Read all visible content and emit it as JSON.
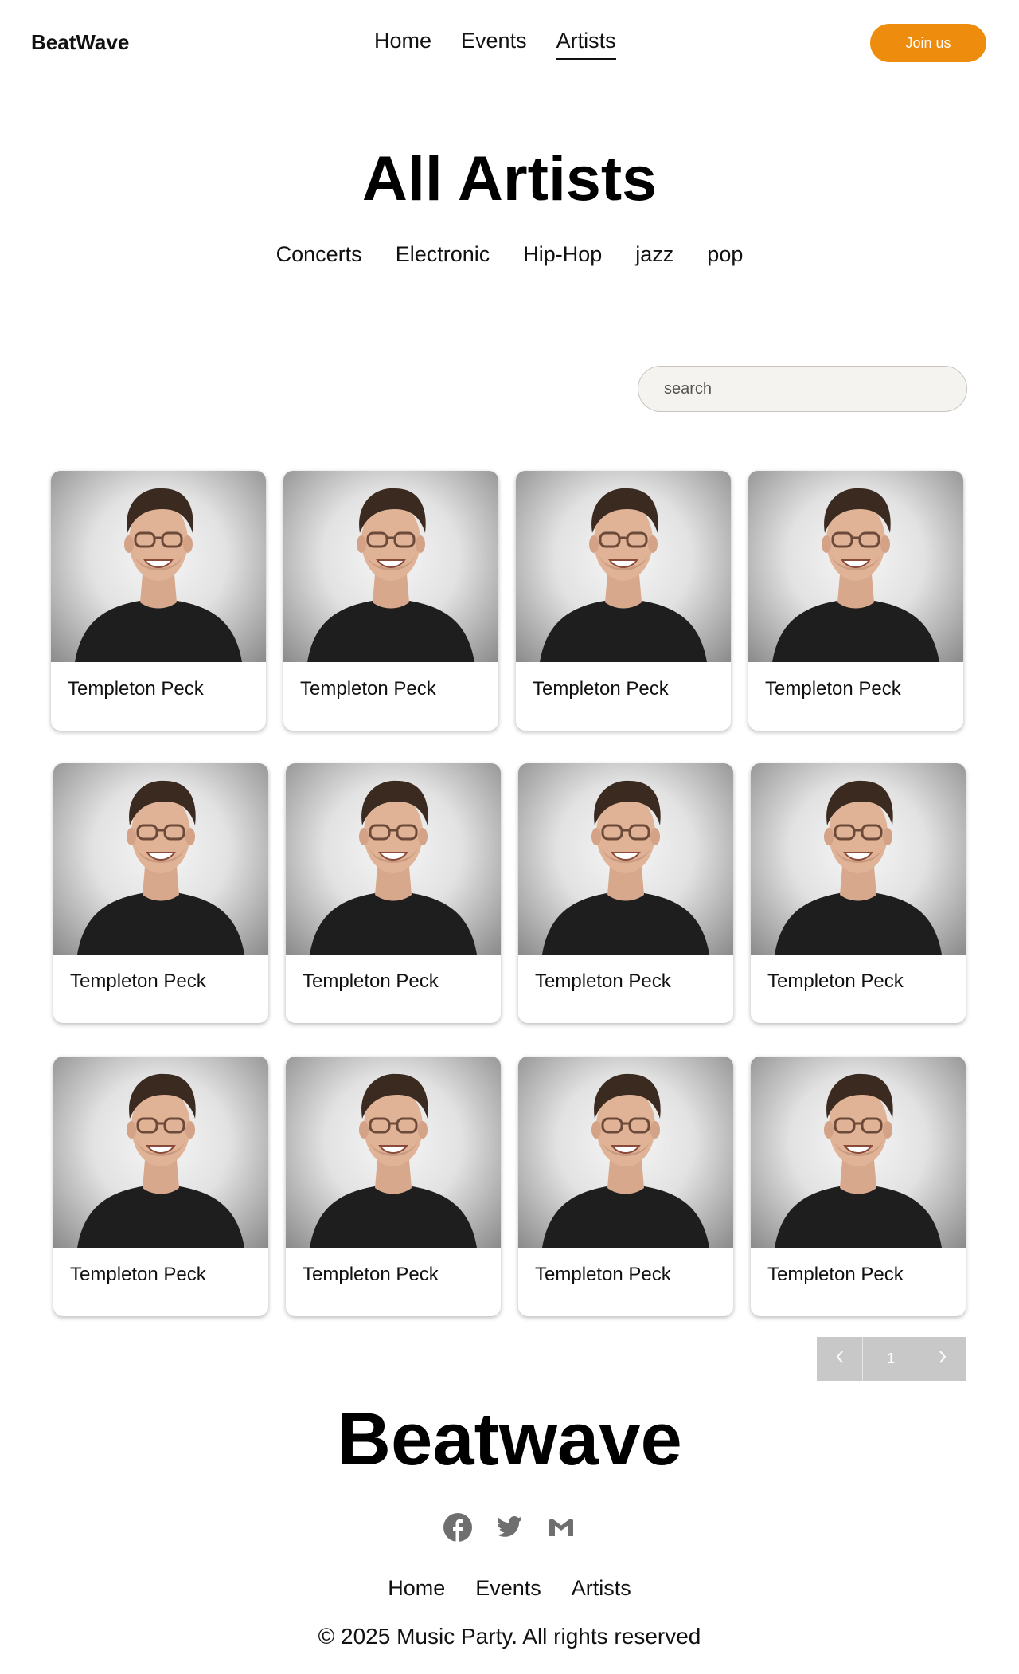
{
  "header": {
    "brand": "BeatWave",
    "nav": [
      {
        "label": "Home",
        "active": false
      },
      {
        "label": "Events",
        "active": false
      },
      {
        "label": "Artists",
        "active": true
      }
    ],
    "join_label": "Join us"
  },
  "hero": {
    "title": "All Artists",
    "genres": [
      "Concerts",
      "Electronic",
      "Hip-Hop",
      "jazz",
      "pop"
    ]
  },
  "search": {
    "placeholder": "search"
  },
  "artists": [
    {
      "name": "Templeton Peck"
    },
    {
      "name": "Templeton Peck"
    },
    {
      "name": "Templeton Peck"
    },
    {
      "name": "Templeton Peck"
    },
    {
      "name": "Templeton Peck"
    },
    {
      "name": "Templeton Peck"
    },
    {
      "name": "Templeton Peck"
    },
    {
      "name": "Templeton Peck"
    },
    {
      "name": "Templeton Peck"
    },
    {
      "name": "Templeton Peck"
    },
    {
      "name": "Templeton Peck"
    },
    {
      "name": "Templeton Peck"
    }
  ],
  "pagination": {
    "prev_icon": "chevron-left-icon",
    "current": "1",
    "next_icon": "chevron-right-icon"
  },
  "footer": {
    "brand": "Beatwave",
    "socials": [
      "facebook-icon",
      "twitter-icon",
      "gmail-icon"
    ],
    "links": [
      "Home",
      "Events",
      "Artists"
    ],
    "copyright": "© 2025 Music Party. All rights reserved"
  },
  "colors": {
    "accent": "#ee8c0d",
    "pager": "#c8c8c8",
    "search_bg": "#f5f3ef"
  }
}
